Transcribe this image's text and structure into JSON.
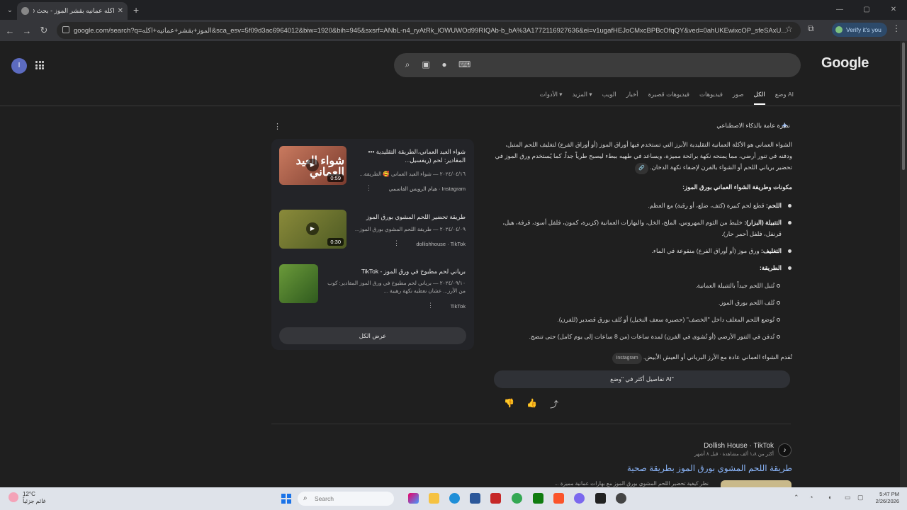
{
  "browser": {
    "tab_title": "اكله عمانيه بقشر الموز - بحث Go",
    "tab_close": "✕",
    "new_tab": "+",
    "url": "google.com/search?q=الموز+بقشر+عمانيه+اكله&sca_esv=5f09d3ac6964012&biw=1920&bih=945&sxsrf=ANbL-n4_ryAtRk_lOWUWOd99RIQAb-b_bA%3A1772116927636&ei=v1ugafHEJoCMxcBPBcOfqQY&ved=0ahUKEwixcOP_sfeSAxU...",
    "verify_label": "Verify it's you",
    "window_controls": [
      "—",
      "▢",
      "✕"
    ]
  },
  "google": {
    "logo": "Google",
    "avatar_letter": "I",
    "tabs": [
      {
        "label": "وضع AI",
        "active": false
      },
      {
        "label": "الكل",
        "active": true
      },
      {
        "label": "صور",
        "active": false
      },
      {
        "label": "فيديوهات",
        "active": false
      },
      {
        "label": "فيديوهات قصيرة",
        "active": false
      },
      {
        "label": "أخبار",
        "active": false
      },
      {
        "label": "الويب",
        "active": false
      },
      {
        "label": "المزيد ▾",
        "active": false
      },
      {
        "label": "الأدوات ▾",
        "active": false
      }
    ]
  },
  "ai_overview": {
    "heading": "نظرة عامة بالذكاء الاصطناعي",
    "intro": "الشواء العماني هو الأكلة العمانية التقليدية الأبرز التي تستخدم فيها أوراق الموز (أو أوراق الفرع) لتغليف اللحم المتبل، ودفنه في تنور أرضي، مما يمنحه نكهة برائحة مميزة، ويساعد في طهيه ببطء ليصبح طرياً جداً. كما يُستخدم ورق الموز في تحضير برياني اللحم أو الشواء بالفرن لإضفاء نكهة الدخان.",
    "section_title": "مكونات وطريقة الشواء العماني بورق الموز:",
    "items": [
      {
        "label": "اللحم:",
        "text": "قطع لحم كبيرة (كتف، ضلع، أو رقبة) مع العظم."
      },
      {
        "label": "التتبيلة (البزار):",
        "text": "خليط من الثوم المهروس، الملح، الخل، والبهارات العمانية (كزبرة، كمون، فلفل أسود، قرفة، هيل، قرنفل، فلفل أحمر حار)."
      },
      {
        "label": "التغليف:",
        "text": "ورق موز (أو أوراق الفرع) منقوعة في الماء."
      },
      {
        "label": "الطريقة:",
        "text": ""
      }
    ],
    "steps": [
      "تُتبل اللحم جيداً بالتتبيلة العمانية.",
      "تُلف اللحم بورق الموز.",
      "تُوضع اللحم المغلف داخل \"الخصف\" (حصيرة سعف النخيل) أو تُلف بورق قصدير (للفرن).",
      "تُدفن في التنور الأرضي (أو تُشوى في الفرن) لمدة ساعات (من 8 ساعات إلى يوم كامل) حتى تنضج."
    ],
    "closing": "تُقدم الشواء العماني عادة مع الأرز البرياني أو العيش الأبيض.",
    "closing_chip": "Instagram",
    "more_button": "تفاصيل أكثر في \"وضع AI\"",
    "feedback": {
      "thumb_down": "👎",
      "thumb_up": "👍",
      "share": "⤴"
    }
  },
  "videos": [
    {
      "title": "شواء العيد العماني،الطريقة التقليدية ••• المقادير: لحم (ريفسيل...",
      "meta": "٢٠٢٤/٠٤/١٦ — شواء العيد العماني 🥰 الطريقة...",
      "source": "Instagram · هيام الرويس القاسمي",
      "duration": "0:59",
      "thumb_text": "شواء العيد العماني",
      "colors": [
        "#c97a5f",
        "#7a3b2e"
      ]
    },
    {
      "title": "طريقة تحضير اللحم المشوي بورق الموز",
      "meta": "٢٠٢٤/٠٤/٠٩ — طريقة اللحم المشوي بورق الموز...",
      "source": "dollishhouse · TikTok",
      "duration": "0:30",
      "thumb_text": "",
      "colors": [
        "#8a8a3a",
        "#4d5a23"
      ]
    },
    {
      "title": "برياني لحم مطبوخ في ورق الموز - TikTok",
      "meta": "٢٠٢٤/٠٩/١٠ — برياني لحم مطبوخ في ورق الموز المقادير: كوب من الأرز... عشان نعطيه نكهة رهيبة ...",
      "source": "TikTok",
      "duration": "",
      "thumb_text": "",
      "colors": [
        "#6b9a3a",
        "#2f5a1e"
      ]
    }
  ],
  "show_all": "عرض الكل",
  "result": {
    "site": "Dollish House · TikTok",
    "sub": "أكثر من ١٫٨ ألف مشاهدة · قبل ٨ أشهر",
    "title": "طريقة اللحم المشوي بورق الموز بطريقة صحية",
    "snippet": "نطر كيفية تحضير اللحم المشوي بورق الموز مع بهارات عمانية مميزة ..."
  },
  "taskbar": {
    "temp": "12°C",
    "weather_desc": "غائم جزئياً",
    "search_placeholder": "Search",
    "time": "5:47 PM",
    "date": "2/26/2026"
  }
}
